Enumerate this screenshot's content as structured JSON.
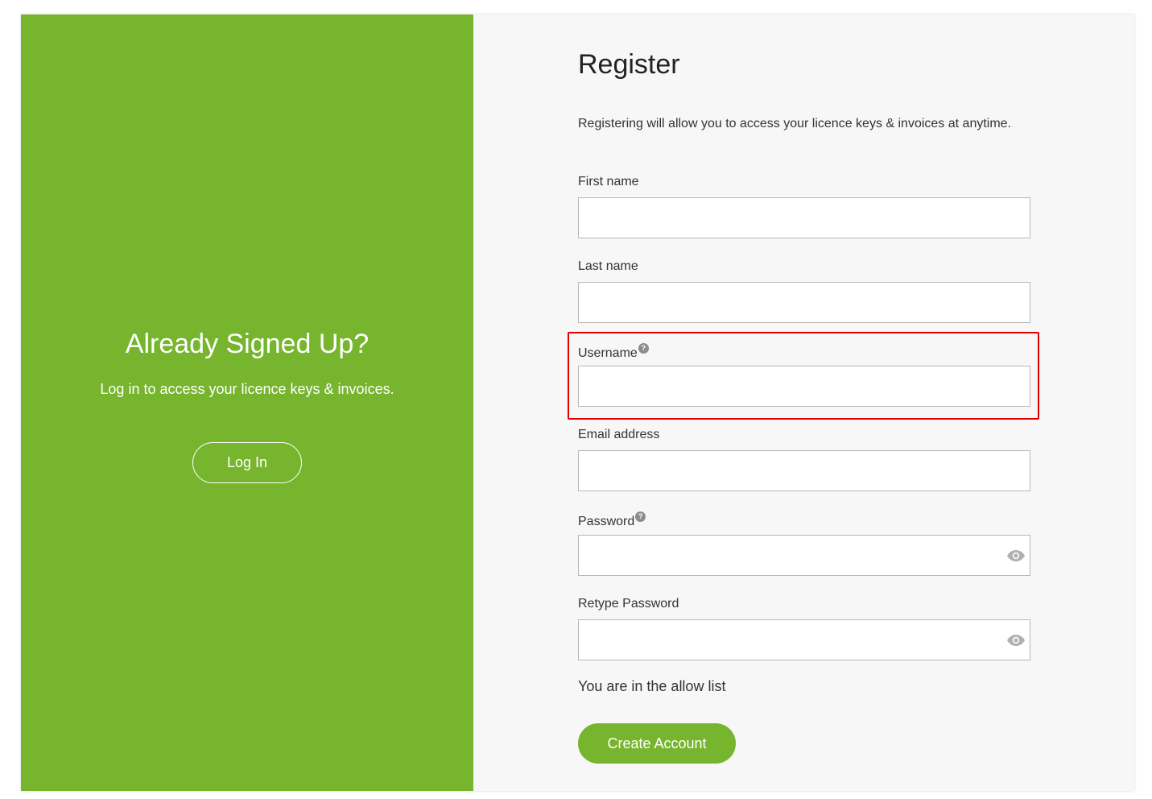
{
  "colors": {
    "brand_green": "#76b52d",
    "highlight_red": "#e00000"
  },
  "left_panel": {
    "heading": "Already Signed Up?",
    "subtext": "Log in to access your licence keys & invoices.",
    "login_label": "Log In"
  },
  "register": {
    "title": "Register",
    "intro": "Registering will allow you to access your licence keys & invoices at anytime.",
    "fields": {
      "first_name": {
        "label": "First name",
        "value": ""
      },
      "last_name": {
        "label": "Last name",
        "value": ""
      },
      "username": {
        "label": "Username",
        "value": "",
        "help_icon": "question-circle-icon"
      },
      "email": {
        "label": "Email address",
        "value": ""
      },
      "password": {
        "label": "Password",
        "value": "",
        "help_icon": "question-circle-icon",
        "toggle_icon": "eye-icon"
      },
      "retype_password": {
        "label": "Retype Password",
        "value": "",
        "toggle_icon": "eye-icon"
      }
    },
    "help_glyph": "?",
    "allow_list_text": "You are in the allow list",
    "create_account_label": "Create Account"
  }
}
